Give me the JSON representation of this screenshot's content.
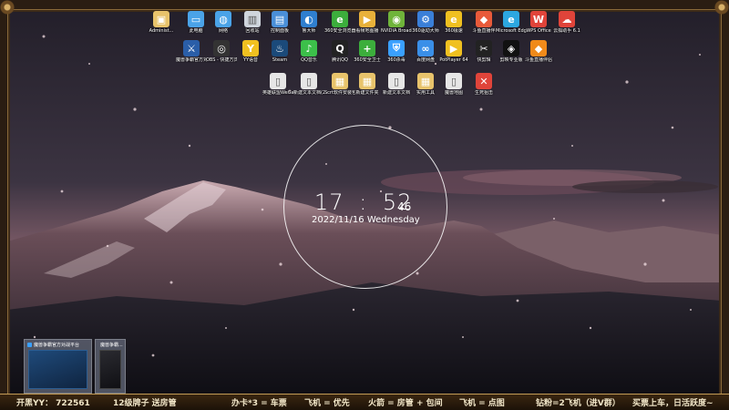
{
  "clock": {
    "hour": "17",
    "sep": ":",
    "minute": "52",
    "second": "46",
    "date": "2022/11/16 Wednesday"
  },
  "desktop_icons": [
    {
      "label": "Administ...",
      "color": "#e8c36b",
      "glyph": "▣"
    },
    {
      "label": "此电脑",
      "color": "#4aa3e8",
      "glyph": "▭"
    },
    {
      "label": "网络",
      "color": "#4aa3e8",
      "glyph": "◍"
    },
    {
      "label": "回收站",
      "color": "#cfd5dd",
      "glyph": "▥"
    },
    {
      "label": "控制面板",
      "color": "#4a8fd8",
      "glyph": "▤"
    },
    {
      "label": "鲁大师",
      "color": "#2f7fd0",
      "glyph": "◐"
    },
    {
      "label": "360安全浏览器",
      "color": "#3cae3c",
      "glyph": "e"
    },
    {
      "label": "看帧地图播",
      "color": "#e8b13a",
      "glyph": "▶"
    },
    {
      "label": "NVIDIA Broadcast",
      "color": "#6fb43a",
      "glyph": "◉"
    },
    {
      "label": "360驱动大师",
      "color": "#3a7fd8",
      "glyph": "⚙"
    },
    {
      "label": "360极速",
      "color": "#f0c020",
      "glyph": "e"
    },
    {
      "label": "斗鱼直播伴",
      "color": "#e85a3a",
      "glyph": "◆"
    },
    {
      "label": "Microsoft Edge",
      "color": "#2ca7e0",
      "glyph": "e"
    },
    {
      "label": "WPS Office",
      "color": "#e0443a",
      "glyph": "W"
    },
    {
      "label": "云狐助手 6.1",
      "color": "#e0443a",
      "glyph": "☁"
    },
    {
      "label": "魔兽争霸官方对战平台",
      "color": "#2a5ea8",
      "glyph": "⚔"
    },
    {
      "label": "OBS - 快捷方式",
      "color": "#333333",
      "glyph": "◎"
    },
    {
      "label": "YY语音",
      "color": "#f0c020",
      "glyph": "Y"
    },
    {
      "label": "Steam",
      "color": "#1b4a7a",
      "glyph": "♨"
    },
    {
      "label": "QQ音乐",
      "color": "#3cbf4a",
      "glyph": "♪"
    },
    {
      "label": "腾讯QQ",
      "color": "#222222",
      "glyph": "Q"
    },
    {
      "label": "360安全卫士",
      "color": "#3cae3c",
      "glyph": "+"
    },
    {
      "label": "360杀毒",
      "color": "#3aa0ff",
      "glyph": "⛨"
    },
    {
      "label": "百度网盘",
      "color": "#3a8fe8",
      "glyph": "∞"
    },
    {
      "label": "PotPlayer 64",
      "color": "#f0c020",
      "glyph": "▶"
    },
    {
      "label": "快剪辑",
      "color": "#222222",
      "glyph": "✂"
    },
    {
      "label": "剪映专业版",
      "color": "#111111",
      "glyph": "◈"
    },
    {
      "label": "斗鱼直播伴侣",
      "color": "#f08a1a",
      "glyph": "◆"
    },
    {
      "label": "英雄联盟WeGame",
      "color": "#e6e6e6",
      "glyph": "▯"
    },
    {
      "label": "新建文本文档(2)",
      "color": "#e6e6e6",
      "glyph": "▯"
    },
    {
      "label": "Scrt软件安装包",
      "color": "#e8c36b",
      "glyph": "▦"
    },
    {
      "label": "新建文件夹",
      "color": "#e8c36b",
      "glyph": "▦"
    },
    {
      "label": "新建文本文档",
      "color": "#e6e6e6",
      "glyph": "▯"
    },
    {
      "label": "实用工具",
      "color": "#e8c36b",
      "glyph": "▦"
    },
    {
      "label": "魔兽地图",
      "color": "#e6e6e6",
      "glyph": "▯"
    },
    {
      "label": "生死狙击",
      "color": "#e0443a",
      "glyph": "✕"
    }
  ],
  "previews": [
    {
      "title": "魔兽争霸官方对战平台"
    },
    {
      "title": "魔兽争霸..."
    }
  ],
  "banner": [
    "开黑YY： 722561",
    "12级牌子 送房管",
    "办卡*3 = 车票",
    "飞机 = 优先",
    "火箭 = 房管 + 包间",
    "飞机 = 点图",
    "钻粉=2飞机（进V群）",
    "买票上车，日活跃度~"
  ]
}
